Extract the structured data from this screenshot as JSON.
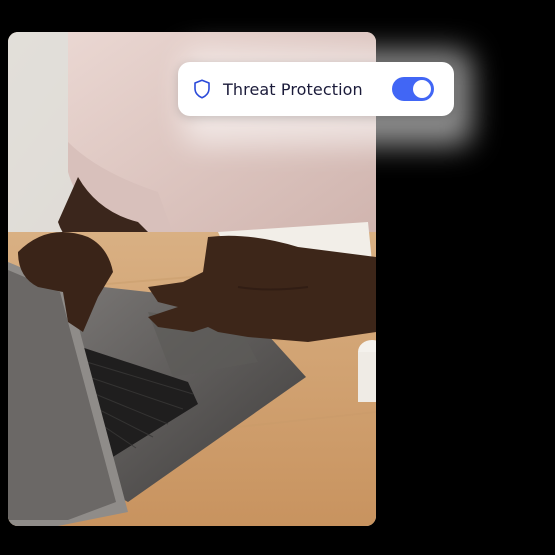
{
  "toggle_card": {
    "label": "Threat Protection",
    "icon": "shield-icon",
    "enabled": true,
    "accent_color": "#4166f5"
  },
  "photo": {
    "subject": "person typing on a laptop at a wooden desk"
  }
}
